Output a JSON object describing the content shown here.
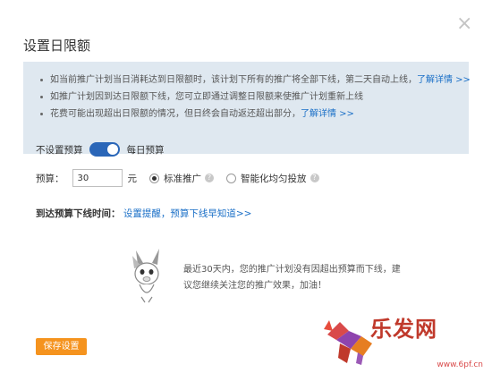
{
  "dialog": {
    "title": "设置日限额",
    "close_symbol": "×"
  },
  "info": {
    "items": [
      {
        "text": "如当前推广计划当日消耗达到日限额时，该计划下所有的推广将全部下线，第二天自动上线，",
        "link": "了解详情 >>"
      },
      {
        "text": "如推广计划因到达日限额下线，您可立即通过调整日限额来使推广计划重新上线",
        "link": ""
      },
      {
        "text": "花费可能出现超出日限额的情况，但日终会自动返还超出部分，",
        "link": "了解详情 >>"
      }
    ]
  },
  "budget_toggle": {
    "off_label": "不设置预算",
    "on_label": "每日预算",
    "is_on": true
  },
  "budget": {
    "label": "预算：",
    "value": "30",
    "unit": "元",
    "options": [
      {
        "label": "标准推广",
        "checked": true
      },
      {
        "label": "智能化均匀投放",
        "checked": false
      }
    ],
    "help_symbol": "?"
  },
  "arrive": {
    "label": "到达预算下线时间：",
    "link": "设置提醒，预算下线早知道>>"
  },
  "notice": {
    "text": "最近30天内，您的推广计划没有因超出预算而下线，建议您继续关注您的推广效果，加油！"
  },
  "actions": {
    "save_label": "保存设置"
  },
  "watermark": {
    "text": "乐发网",
    "url": "www.6pf.cn"
  },
  "colors": {
    "accent": "#2a66b8",
    "link": "#1a6fc7",
    "save_button": "#f5931e",
    "info_bg": "#dfe8f0"
  }
}
